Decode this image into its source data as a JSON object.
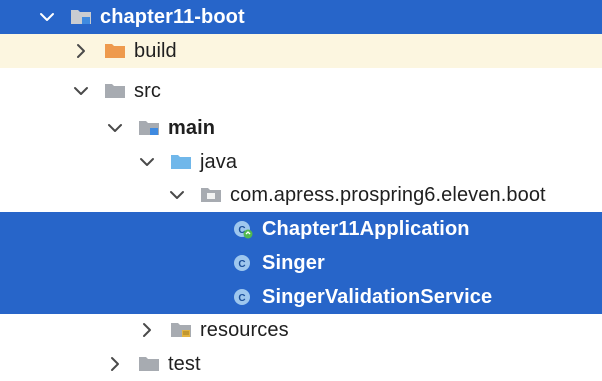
{
  "project_tree": {
    "rows": [
      {
        "label": "chapter11-boot",
        "icon": "module-folder-icon"
      },
      {
        "label": "build",
        "icon": "excluded-folder-icon"
      },
      {
        "label": "src",
        "icon": "folder-icon"
      },
      {
        "label": "main",
        "icon": "source-root-folder-icon"
      },
      {
        "label": "java",
        "icon": "source-folder-icon"
      },
      {
        "label": "com.apress.prospring6.eleven.boot",
        "icon": "package-icon"
      },
      {
        "label": "Chapter11Application",
        "icon": "spring-boot-class-icon"
      },
      {
        "label": "Singer",
        "icon": "class-icon"
      },
      {
        "label": "SingerValidationService",
        "icon": "class-icon"
      },
      {
        "label": "resources",
        "icon": "resources-folder-icon"
      },
      {
        "label": "test",
        "icon": "folder-icon"
      }
    ]
  },
  "colors": {
    "selection": "#2765c9",
    "excluded_highlight": "#fcf6e0",
    "folder_gray": "#a7abb1",
    "module_blue": "#3f8ae0",
    "excluded_orange": "#ee9a4d",
    "source_blue": "#70b7ea"
  }
}
